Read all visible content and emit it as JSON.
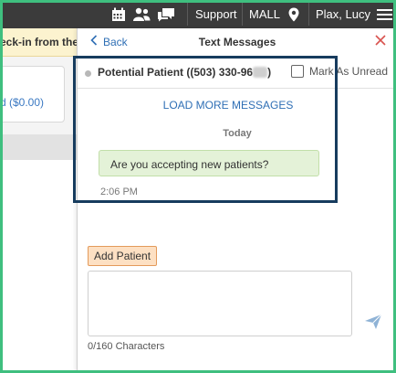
{
  "topbar": {
    "icons": [
      "calendar-icon",
      "people-icon",
      "chat-icon",
      "location-pin-icon",
      "hamburger-menu-icon"
    ],
    "support_label": "Support",
    "location_label": "MALL",
    "user_label": "Plax, Lucy",
    "background_color": "#3b3b3b"
  },
  "background_page": {
    "banner_text": "eck-in from their v",
    "card_amount": "d ($0.00)"
  },
  "panel": {
    "back_label": "Back",
    "title": "Text Messages",
    "close_icon": "close-icon"
  },
  "conversation": {
    "contact_name": "Potential Patient ((503) 330-96",
    "contact_name_suffix": ")",
    "mark_unread_label": "Mark As Unread",
    "mark_unread_checked": false,
    "load_more_label": "LOAD MORE MESSAGES",
    "day_label": "Today",
    "messages": [
      {
        "text": "Are you accepting new patients?",
        "time": "2:06 PM"
      }
    ]
  },
  "compose": {
    "add_patient_label": "Add Patient",
    "value": "",
    "char_count": "0/160 Characters",
    "send_icon": "send-icon"
  },
  "colors": {
    "link": "#2f6fb5",
    "close": "#d9534f",
    "bubble": "#e4f2d8",
    "highlight_border": "#173c5e",
    "frame_border": "#3fbf7f",
    "add_patient_bg": "#fde0c3"
  }
}
